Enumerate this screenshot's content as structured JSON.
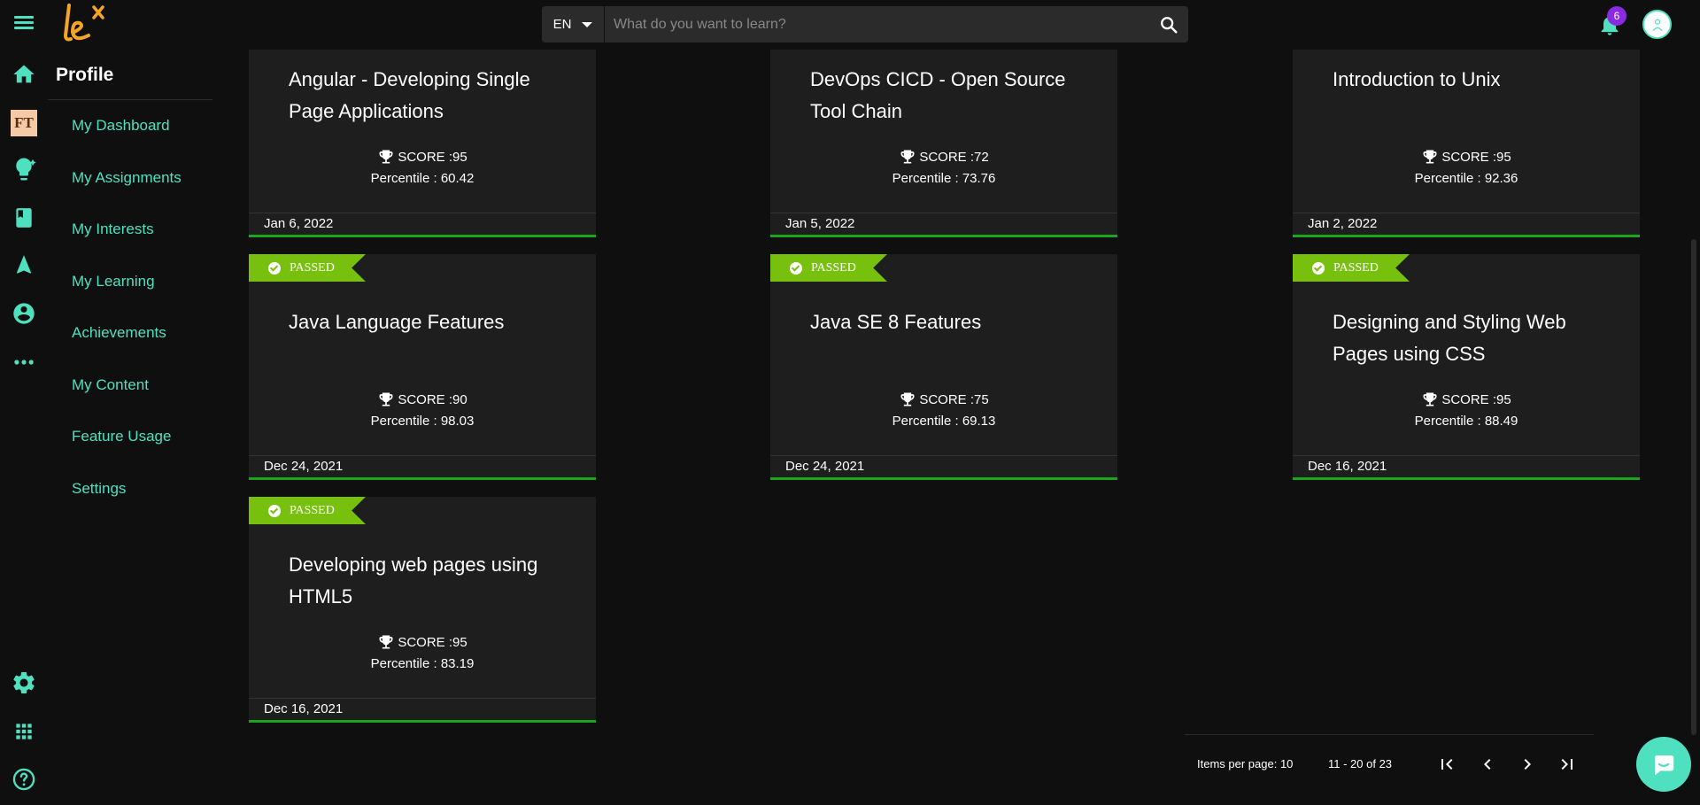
{
  "header": {
    "lang": "EN",
    "search_placeholder": "What do you want to learn?",
    "notification_count": "6"
  },
  "rail": {
    "badge_text": "FT",
    "icons": [
      "home-icon",
      "lightbulb-icon",
      "book-icon",
      "navigation-icon",
      "account-circle-icon",
      "more-horiz-icon",
      "settings-icon",
      "apps-icon",
      "help-icon"
    ]
  },
  "profile_menu": {
    "title": "Profile",
    "items": [
      {
        "label": "My Dashboard"
      },
      {
        "label": "My Assignments"
      },
      {
        "label": "My Interests"
      },
      {
        "label": "My Learning"
      },
      {
        "label": "Achievements"
      },
      {
        "label": "My Content"
      },
      {
        "label": "Feature Usage"
      },
      {
        "label": "Settings"
      }
    ]
  },
  "cards": [
    {
      "title": "Angular - Developing Single Page Applications",
      "score": "SCORE :95",
      "percentile": "Percentile : 60.42",
      "date": "Jan 6, 2022",
      "passed": ""
    },
    {
      "title": "DevOps CICD - Open Source Tool Chain",
      "score": "SCORE :72",
      "percentile": "Percentile : 73.76",
      "date": "Jan 5, 2022",
      "passed": ""
    },
    {
      "title": "Introduction to Unix",
      "score": "SCORE :95",
      "percentile": "Percentile : 92.36",
      "date": "Jan 2, 2022",
      "passed": ""
    },
    {
      "title": "Java Language Features",
      "score": "SCORE :90",
      "percentile": "Percentile : 98.03",
      "date": "Dec 24, 2021",
      "passed": "PASSED"
    },
    {
      "title": "Java SE 8 Features",
      "score": "SCORE :75",
      "percentile": "Percentile : 69.13",
      "date": "Dec 24, 2021",
      "passed": "PASSED"
    },
    {
      "title": "Designing and Styling Web Pages using CSS",
      "score": "SCORE :95",
      "percentile": "Percentile : 88.49",
      "date": "Dec 16, 2021",
      "passed": "PASSED"
    },
    {
      "title": "Developing web pages using HTML5",
      "score": "SCORE :95",
      "percentile": "Percentile : 83.19",
      "date": "Dec 16, 2021",
      "passed": "PASSED"
    }
  ],
  "pagination": {
    "items_per_page": "Items per page: 10",
    "range": "11 - 20 of 23"
  },
  "colors": {
    "accent": "#4fe0c0",
    "passed": "#77c10e",
    "card_bottom": "#1aa51a",
    "badge": "#8a2be2"
  }
}
